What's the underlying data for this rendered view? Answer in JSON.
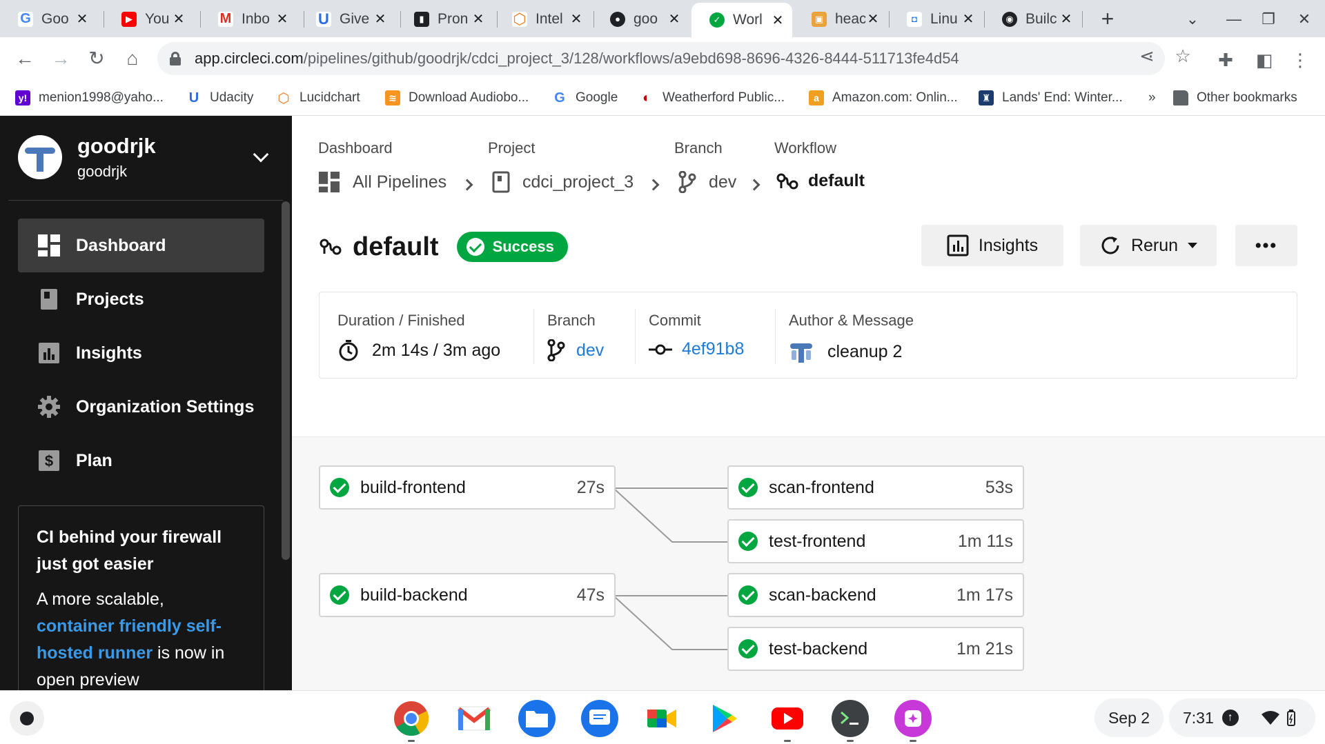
{
  "browser": {
    "tabs": [
      {
        "label": "Goo",
        "fav_color": "#ffffff",
        "fav_text": "G",
        "fav_fg": "#4285f4"
      },
      {
        "label": "You",
        "fav_color": "#ff0000",
        "fav_text": "▶",
        "fav_fg": "#ffffff"
      },
      {
        "label": "Inbo",
        "fav_color": "#ffffff",
        "fav_text": "M",
        "fav_fg": "#d93025"
      },
      {
        "label": "Give",
        "fav_color": "#ffffff",
        "fav_text": "U",
        "fav_fg": "#2d6cdf"
      },
      {
        "label": "Pron",
        "fav_color": "#202124",
        "fav_text": "▮",
        "fav_fg": "#ffffff"
      },
      {
        "label": "Intel",
        "fav_color": "#ffffff",
        "fav_text": "⬡",
        "fav_fg": "#f47b20"
      },
      {
        "label": "goo",
        "fav_color": "#202124",
        "fav_text": "●",
        "fav_fg": "#ffffff"
      },
      {
        "label": "Worl",
        "fav_color": "#00a63f",
        "fav_text": "✓",
        "fav_fg": "#ffffff"
      },
      {
        "label": "heac",
        "fav_color": "#e8a33d",
        "fav_text": "▣",
        "fav_fg": "#ffffff"
      },
      {
        "label": "Linu",
        "fav_color": "#ffffff",
        "fav_text": "◘",
        "fav_fg": "#1a73e8"
      },
      {
        "label": "Builc",
        "fav_color": "#202124",
        "fav_text": "◉",
        "fav_fg": "#ffffff"
      }
    ],
    "active_tab_index": 7,
    "url_host": "app.circleci.com",
    "url_path": "/pipelines/github/goodrjk/cdci_project_3/128/workflows/a9ebd698-8696-4326-8444-511713fe4d54",
    "bookmarks": [
      {
        "label": "menion1998@yaho...",
        "icon_color": "#6001d2",
        "icon_text": "y!"
      },
      {
        "label": "Udacity",
        "icon_color": "#ffffff",
        "icon_text": "U",
        "icon_fg": "#2d6cdf"
      },
      {
        "label": "Lucidchart",
        "icon_color": "#ffffff",
        "icon_text": "⬡",
        "icon_fg": "#f47b20"
      },
      {
        "label": "Download Audiobo...",
        "icon_color": "#f79520",
        "icon_text": "≋"
      },
      {
        "label": "Google",
        "icon_color": "#ffffff",
        "icon_text": "G",
        "icon_fg": "#4285f4"
      },
      {
        "label": "Weatherford Public...",
        "icon_color": "#ffffff",
        "icon_text": "◐",
        "icon_fg": "#c00000"
      },
      {
        "label": "Amazon.com: Onlin...",
        "icon_color": "#f0a020",
        "icon_text": "a"
      },
      {
        "label": "Lands' End: Winter...",
        "icon_color": "#1d3c6e",
        "icon_text": "♜"
      }
    ],
    "bookmarks_overflow": "»",
    "other_bookmarks": "Other bookmarks"
  },
  "sidebar": {
    "org_name": "goodrjk",
    "org_user": "goodrjk",
    "nav": [
      {
        "label": "Dashboard",
        "icon": "dashboard-icon",
        "active": true
      },
      {
        "label": "Projects",
        "icon": "projects-icon",
        "active": false
      },
      {
        "label": "Insights",
        "icon": "insights-icon",
        "active": false
      },
      {
        "label": "Organization Settings",
        "icon": "gear-icon",
        "active": false
      },
      {
        "label": "Plan",
        "icon": "dollar-icon",
        "active": false
      }
    ],
    "promo": {
      "title": "CI behind your firewall just got easier",
      "body_pre": "A more scalable,",
      "link": "container friendly self-hosted runner",
      "body_post": "is now in open preview"
    }
  },
  "breadcrumb": {
    "labels": {
      "dashboard": "Dashboard",
      "project": "Project",
      "branch": "Branch",
      "workflow": "Workflow"
    },
    "values": {
      "dashboard": "All Pipelines",
      "project": "cdci_project_3",
      "branch": "dev",
      "workflow": "default"
    }
  },
  "header": {
    "title": "default",
    "status": "Success",
    "insights_label": "Insights",
    "rerun_label": "Rerun",
    "more_label": "•••"
  },
  "summary": {
    "duration_label": "Duration / Finished",
    "duration_value": "2m 14s / 3m ago",
    "branch_label": "Branch",
    "branch_value": "dev",
    "commit_label": "Commit",
    "commit_value": "4ef91b8",
    "author_label": "Author & Message",
    "message": "cleanup 2"
  },
  "jobs": {
    "build_frontend": {
      "name": "build-frontend",
      "duration": "27s"
    },
    "scan_frontend": {
      "name": "scan-frontend",
      "duration": "53s"
    },
    "test_frontend": {
      "name": "test-frontend",
      "duration": "1m 11s"
    },
    "build_backend": {
      "name": "build-backend",
      "duration": "47s"
    },
    "scan_backend": {
      "name": "scan-backend",
      "duration": "1m 17s"
    },
    "test_backend": {
      "name": "test-backend",
      "duration": "1m 21s"
    }
  },
  "shelf": {
    "date": "Sep 2",
    "time": "7:31"
  },
  "colors": {
    "success": "#00a63f",
    "link": "#1e7bd6",
    "sidebar_bg": "#161616"
  }
}
